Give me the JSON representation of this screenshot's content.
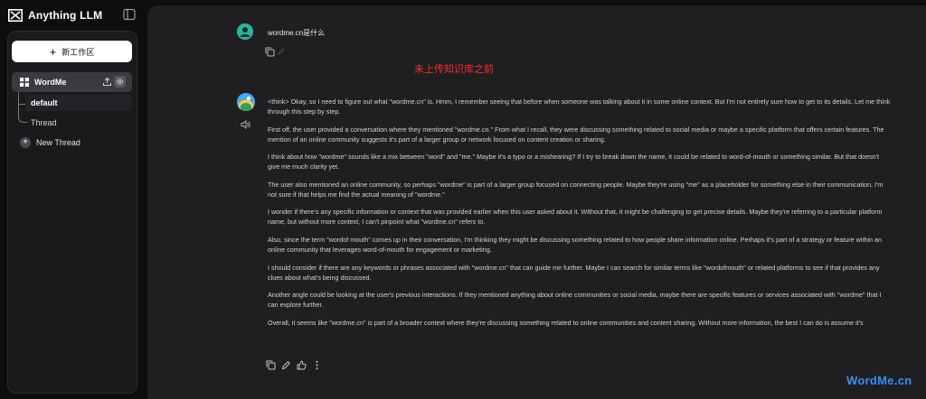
{
  "app": {
    "name": "Anything LLM"
  },
  "sidebar": {
    "new_workspace_label": "新工作区",
    "workspace": {
      "name": "WordMe",
      "threads": [
        {
          "label": "default",
          "active": true
        },
        {
          "label": "Thread",
          "active": false
        }
      ]
    },
    "new_thread_label": "New Thread"
  },
  "chat": {
    "user_message": "wordme.cn是什么",
    "annotation": "未上传知识库之前",
    "assistant_paragraphs": [
      "<think> Okay, so I need to figure out what \"wordme.cn\" is. Hmm, I remember seeing that before when someone was talking about it in some online context. But I'm not entirely sure how to get to its details. Let me think through this step by step.",
      "First off, the user provided a conversation where they mentioned \"wordme.cn.\" From what I recall, they were discussing something related to social media or maybe a specific platform that offers certain features. The mention of an online community suggests it's part of a larger group or network focused on content creation or sharing.",
      "I think about how \"wordme\" sounds like a mix between \"word\" and \"me.\" Maybe it's a typo or a mishearing? If I try to break down the name, it could be related to word-of-mouth or something similar. But that doesn't give me much clarity yet.",
      "The user also mentioned an online community, so perhaps \"wordme\" is part of a larger group focused on connecting people. Maybe they're using \"me\" as a placeholder for something else in their communication. I'm not sure if that helps me find the actual meaning of \"wordme.\"",
      "I wonder if there's any specific information or context that was provided earlier when this user asked about it. Without that, it might be challenging to get precise details. Maybe they're referring to a particular platform name, but without more context, I can't pinpoint what \"wordme.cn\" refers to.",
      "Also, since the term \"wordof mouth\" comes up in their conversation, I'm thinking they might be discussing something related to how people share information online. Perhaps it's part of a strategy or feature within an online community that leverages word-of-mouth for engagement or marketing.",
      "I should consider if there are any keywords or phrases associated with \"wordme.cn\" that can guide me further. Maybe I can search for similar terms like \"wordofmouth\" or related platforms to see if that provides any clues about what's being discussed.",
      "Another angle could be looking at the user's previous interactions. If they mentioned anything about online communities or social media, maybe there are specific features or services associated with \"wordme\" that I can explore further.",
      "Overall, it seems like \"wordme.cn\" is part of a broader context where they're discussing something related to online communities and content sharing. Without more information, the best I can do is assume it's"
    ]
  },
  "watermark": "WordMe.cn",
  "colors": {
    "background": "#0e0e11",
    "panel": "#1f1f22",
    "annotation": "#ff2a2a",
    "watermark": "#3a8ff0"
  }
}
